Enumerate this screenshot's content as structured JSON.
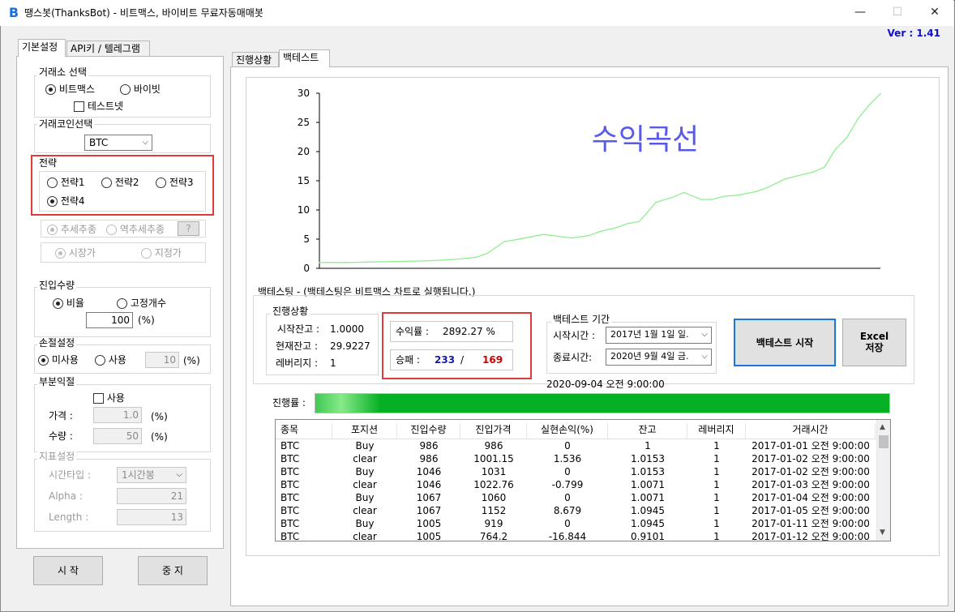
{
  "window": {
    "title": "땡스봇(ThanksBot) - 비트맥스, 바이비트 무료자동매매봇",
    "logo_glyph": "B",
    "minimize": "—",
    "maximize": "☐",
    "close": "✕",
    "version": "Ver :  1.41"
  },
  "left_tabs": [
    "기본설정",
    "API키 / 텔레그램"
  ],
  "exchange": {
    "label": "거래소 선택",
    "options": [
      "비트맥스",
      "바이빗"
    ],
    "selected": 0,
    "testnet_label": "테스트넷"
  },
  "coin": {
    "label": "거래코인선택",
    "value": "BTC"
  },
  "strategy": {
    "label": "전략",
    "options": [
      "전략1",
      "전략2",
      "전략3",
      "전략4"
    ],
    "selected": 3
  },
  "trend": {
    "options": [
      "추세추종",
      "역추세추종"
    ],
    "help": "?"
  },
  "order_type": {
    "options": [
      "시장가",
      "지정가"
    ]
  },
  "entry": {
    "label": "진입수량",
    "options": [
      "비율",
      "고정개수"
    ],
    "value": "100",
    "unit": "(%)"
  },
  "stoploss": {
    "label": "손절설정",
    "options": [
      "미사용",
      "사용"
    ],
    "value": "10",
    "unit": "(%)"
  },
  "partial": {
    "label": "부분익절",
    "use_label": "사용",
    "price_label": "가격 :",
    "price_value": "1.0",
    "qty_label": "수량 :",
    "qty_value": "50",
    "unit": "(%)"
  },
  "indicator": {
    "label": "지표설정",
    "timeframe_label": "시간타입 :",
    "timeframe_value": "1시간봉",
    "alpha_label": "Alpha :",
    "alpha_value": "21",
    "length_label": "Length :",
    "length_value": "13"
  },
  "bottom_buttons": {
    "start": "시 작",
    "stop": "중 지"
  },
  "right_tabs": [
    "진행상황",
    "백테스트"
  ],
  "chart_data": {
    "type": "line",
    "title": "수익곡선",
    "ylim": [
      0,
      30
    ],
    "yticks": [
      "0",
      "5",
      "10",
      "15",
      "20",
      "25",
      "30"
    ],
    "color": "#90ee90",
    "x": [
      0,
      5,
      10,
      15,
      20,
      25,
      28,
      30,
      33,
      35,
      40,
      45,
      48,
      50,
      53,
      55,
      57,
      60,
      63,
      65,
      68,
      70,
      72,
      75,
      78,
      80,
      83,
      85,
      88,
      90,
      92,
      94,
      96,
      98,
      100
    ],
    "y": [
      1.0,
      1.0,
      1.1,
      1.2,
      1.3,
      1.6,
      1.9,
      2.6,
      4.6,
      4.9,
      5.8,
      5.2,
      5.6,
      6.3,
      7.0,
      7.7,
      8.0,
      11.3,
      12.2,
      13.0,
      11.8,
      11.8,
      12.3,
      12.6,
      13.2,
      13.9,
      15.3,
      15.8,
      16.5,
      17.3,
      20.4,
      22.4,
      25.6,
      28.0,
      29.9
    ]
  },
  "backtest": {
    "header": "백테스팅 - (백테스팅은 비트맥스 차트로 실행됩니다.)",
    "progress_label": "진행상황",
    "start_balance_label": "시작잔고 :",
    "start_balance": "1.0000",
    "current_balance_label": "현재잔고 :",
    "current_balance": "29.9227",
    "leverage_label": "레버리지 :",
    "leverage": "1",
    "return_label": "수익률 :",
    "return_value": "2892.27 %",
    "winloss_label": "승패 :",
    "wins": "233",
    "sep": "/",
    "losses": "169",
    "period_label": "백테스트 기간",
    "start_time_label": "시작시간 :",
    "start_time": "2017년   1월   1일 일.",
    "end_time_label": "종료시간:",
    "end_time": "2020년   9월   4일 금.",
    "run_button": "백테스트 시작",
    "excel_button_1": "Excel",
    "excel_button_2": "저장",
    "timestamp": "2020-09-04 오전 9:00:00",
    "bar_label": "진행률 :",
    "bar_percent": 100,
    "colors": {
      "win": "#1a1aa8",
      "loss": "#d00000",
      "bar": "#06b025"
    }
  },
  "trades": {
    "columns": [
      "종목",
      "포지션",
      "진입수량",
      "진입가격",
      "실현손익(%)",
      "잔고",
      "레버리지",
      "거래시간"
    ],
    "rows": [
      [
        "BTC",
        "Buy",
        "986",
        "986",
        "0",
        "1",
        "1",
        "2017-01-01 오전 9:00:00"
      ],
      [
        "BTC",
        "clear",
        "986",
        "1001.15",
        "1.536",
        "1.0153",
        "1",
        "2017-01-02 오전 9:00:00"
      ],
      [
        "BTC",
        "Buy",
        "1046",
        "1031",
        "0",
        "1.0153",
        "1",
        "2017-01-02 오전 9:00:00"
      ],
      [
        "BTC",
        "clear",
        "1046",
        "1022.76",
        "-0.799",
        "1.0071",
        "1",
        "2017-01-03 오전 9:00:00"
      ],
      [
        "BTC",
        "Buy",
        "1067",
        "1060",
        "0",
        "1.0071",
        "1",
        "2017-01-04 오전 9:00:00"
      ],
      [
        "BTC",
        "clear",
        "1067",
        "1152",
        "8.679",
        "1.0945",
        "1",
        "2017-01-05 오전 9:00:00"
      ],
      [
        "BTC",
        "Buy",
        "1005",
        "919",
        "0",
        "1.0945",
        "1",
        "2017-01-11 오전 9:00:00"
      ],
      [
        "BTC",
        "clear",
        "1005",
        "764.2",
        "-16.844",
        "0.9101",
        "1",
        "2017-01-12 오전 9:00:00"
      ]
    ]
  }
}
